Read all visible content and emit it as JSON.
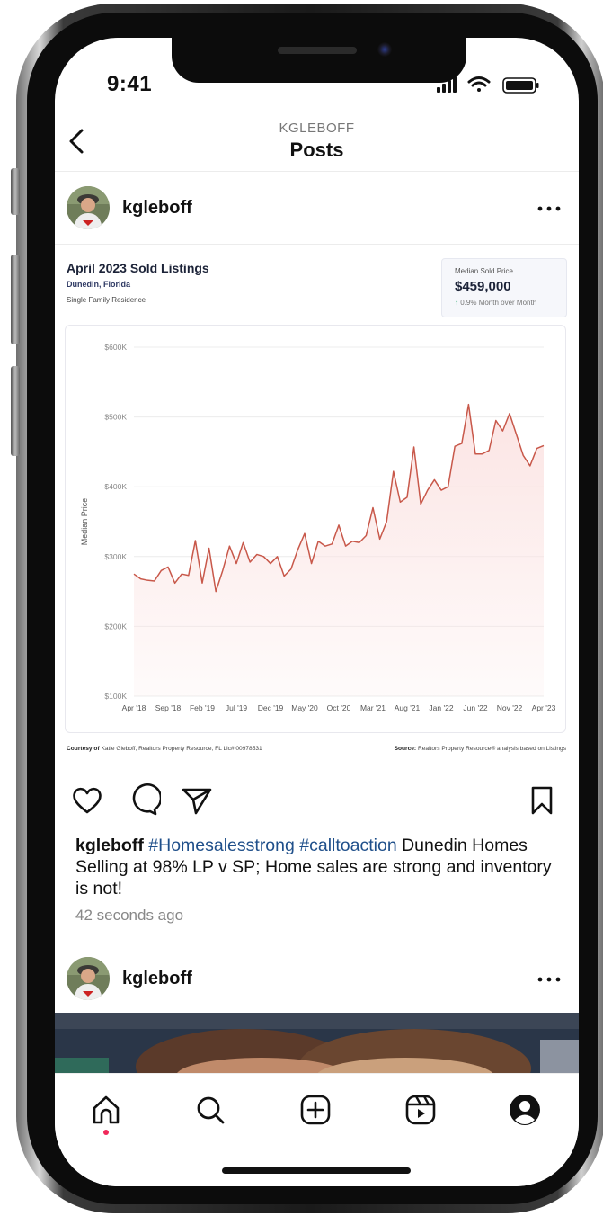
{
  "status_bar": {
    "time": "9:41"
  },
  "header": {
    "account": "KGLEBOFF",
    "title": "Posts"
  },
  "post1": {
    "username": "kgleboff",
    "card": {
      "title": "April 2023 Sold Listings",
      "location": "Dunedin, Florida",
      "property_type": "Single Family Residence",
      "stat_label": "Median Sold Price",
      "stat_value": "$459,000",
      "stat_change": "0.9% Month over Month",
      "footer_left_bold": "Courtesy of",
      "footer_left": "Katie Gleboff, Realtors Property Resource, FL Lic# 00978531",
      "footer_right_bold": "Source:",
      "footer_right": "Realtors Property Resource® analysis based on Listings"
    },
    "caption": {
      "username": "kgleboff",
      "tags": "#Homesalesstrong #calltoaction",
      "text": "Dunedin Homes Selling at 98% LP v SP; Home sales are strong and inventory is not!"
    },
    "time_ago": "42 seconds ago"
  },
  "post2": {
    "username": "kgleboff"
  },
  "colors": {
    "line": "#c8584a",
    "area": "#fbe3e2",
    "hashtag": "#1f4f8a",
    "notification_dot": "#f0285a",
    "up_arrow": "#1aa563"
  },
  "chart_data": {
    "type": "area",
    "title": "",
    "xlabel": "",
    "ylabel": "Median Price",
    "ylim": [
      100000,
      600000
    ],
    "yticks": [
      "$100K",
      "$200K",
      "$300K",
      "$400K",
      "$500K",
      "$600K"
    ],
    "xticks": [
      "Apr '18",
      "Sep '18",
      "Feb '19",
      "Jul '19",
      "Dec '19",
      "May '20",
      "Oct '20",
      "Mar '21",
      "Aug '21",
      "Jan '22",
      "Jun '22",
      "Nov '22",
      "Apr '23"
    ],
    "x": [
      "Apr '18",
      "May '18",
      "Jun '18",
      "Jul '18",
      "Aug '18",
      "Sep '18",
      "Oct '18",
      "Nov '18",
      "Dec '18",
      "Jan '19",
      "Feb '19",
      "Mar '19",
      "Apr '19",
      "May '19",
      "Jun '19",
      "Jul '19",
      "Aug '19",
      "Sep '19",
      "Oct '19",
      "Nov '19",
      "Dec '19",
      "Jan '20",
      "Feb '20",
      "Mar '20",
      "Apr '20",
      "May '20",
      "Jun '20",
      "Jul '20",
      "Aug '20",
      "Sep '20",
      "Oct '20",
      "Nov '20",
      "Dec '20",
      "Jan '21",
      "Feb '21",
      "Mar '21",
      "Apr '21",
      "May '21",
      "Jun '21",
      "Jul '21",
      "Aug '21",
      "Sep '21",
      "Oct '21",
      "Nov '21",
      "Dec '21",
      "Jan '22",
      "Feb '22",
      "Mar '22",
      "Apr '22",
      "May '22",
      "Jun '22",
      "Jul '22",
      "Aug '22",
      "Sep '22",
      "Oct '22",
      "Nov '22",
      "Dec '22",
      "Jan '23",
      "Feb '23",
      "Mar '23",
      "Apr '23"
    ],
    "series": [
      {
        "values": [
          275000,
          268000,
          266000,
          265000,
          280000,
          285000,
          262000,
          275000,
          273000,
          323000,
          262000,
          312000,
          250000,
          280000,
          315000,
          290000,
          320000,
          292000,
          303000,
          300000,
          290000,
          300000,
          272000,
          282000,
          310000,
          333000,
          290000,
          322000,
          315000,
          318000,
          345000,
          315000,
          322000,
          320000,
          330000,
          370000,
          325000,
          350000,
          422000,
          378000,
          385000,
          457000,
          375000,
          395000,
          410000,
          395000,
          400000,
          458000,
          462000,
          518000,
          447000,
          447000,
          452000,
          495000,
          480000,
          505000,
          475000,
          445000,
          430000,
          455000,
          459000
        ]
      }
    ]
  }
}
